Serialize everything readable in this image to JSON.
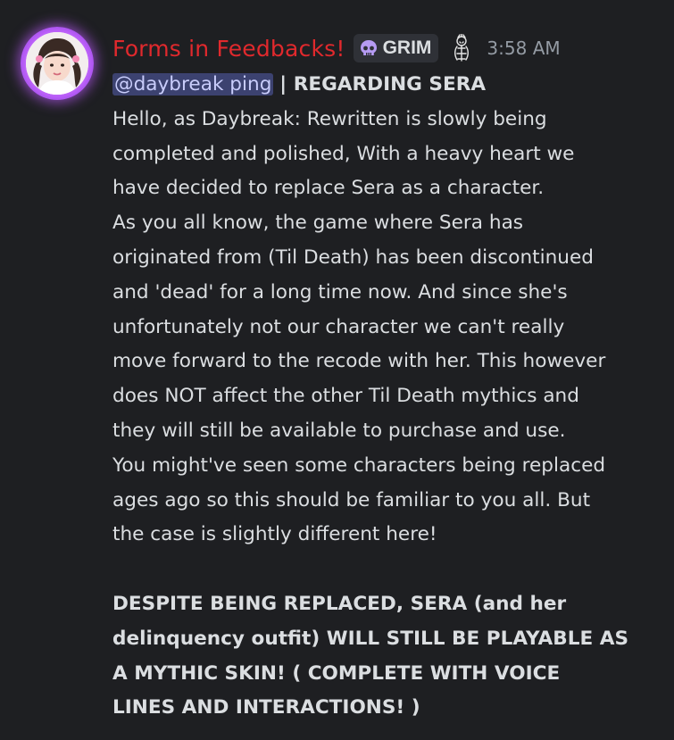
{
  "author": {
    "name": "Forms in Feedbacks!",
    "name_color": "#e0292d"
  },
  "tag": {
    "icon": "skull-icon",
    "label": "GRIM"
  },
  "badge_icon": "sketch-figure-icon",
  "timestamp": "3:58 AM",
  "message": {
    "mention": "@daybreak ping",
    "heading": "| REGARDING SERA",
    "lines": [
      "Hello, as Daybreak: Rewritten is slowly being",
      "completed and polished, With a heavy heart we",
      "have decided to replace Sera as a character.",
      "As you all know, the game where Sera has",
      "originated from (Til Death) has been discontinued",
      "and 'dead' for a long time now. And since she's",
      "unfortunately not our character we can't really",
      "move forward to the recode with her. This however",
      "does NOT affect the other Til Death mythics and",
      "they will still be available to purchase and use.",
      "You might've seen some characters being replaced",
      "ages ago so this should be familiar to you all. But",
      "the case is slightly different here!"
    ],
    "bold_lines": [
      "DESPITE BEING REPLACED, SERA (and her",
      "delinquency outfit) WILL STILL BE PLAYABLE AS",
      "A MYTHIC SKIN! ( COMPLETE WITH VOICE",
      "LINES AND INTERACTIONS! )"
    ]
  }
}
